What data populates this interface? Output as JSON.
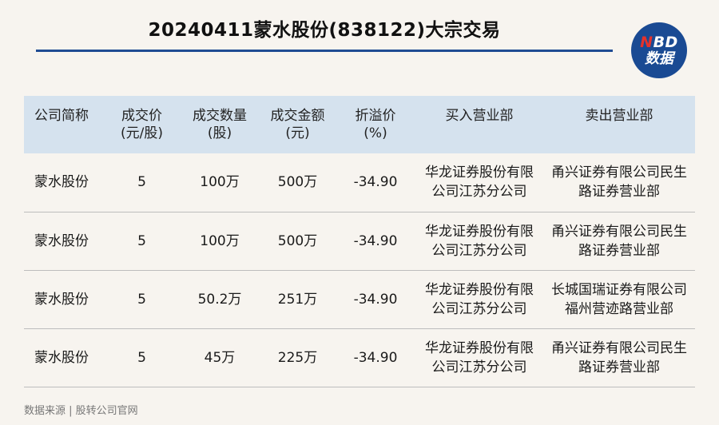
{
  "title": "20240411蒙水股份(838122)大宗交易",
  "logo": {
    "line1_n": "N",
    "line1_rest": "BD",
    "line2": "数据"
  },
  "table": {
    "headers": [
      {
        "line1": "公司简称",
        "line2": ""
      },
      {
        "line1": "成交价",
        "line2": "(元/股)"
      },
      {
        "line1": "成交数量",
        "line2": "(股)"
      },
      {
        "line1": "成交金额",
        "line2": "(元)"
      },
      {
        "line1": "折溢价",
        "line2": "(%)"
      },
      {
        "line1": "买入营业部",
        "line2": ""
      },
      {
        "line1": "卖出营业部",
        "line2": ""
      }
    ],
    "rows": [
      {
        "name": "蒙水股份",
        "price": "5",
        "volume": "100万",
        "amount": "500万",
        "premium": "-34.90",
        "buyer": "华龙证券股份有限公司江苏分公司",
        "seller": "甬兴证券有限公司民生路证券营业部"
      },
      {
        "name": "蒙水股份",
        "price": "5",
        "volume": "100万",
        "amount": "500万",
        "premium": "-34.90",
        "buyer": "华龙证券股份有限公司江苏分公司",
        "seller": "甬兴证券有限公司民生路证券营业部"
      },
      {
        "name": "蒙水股份",
        "price": "5",
        "volume": "50.2万",
        "amount": "251万",
        "premium": "-34.90",
        "buyer": "华龙证券股份有限公司江苏分公司",
        "seller": "长城国瑞证券有限公司福州营迹路营业部"
      },
      {
        "name": "蒙水股份",
        "price": "5",
        "volume": "45万",
        "amount": "225万",
        "premium": "-34.90",
        "buyer": "华龙证券股份有限公司江苏分公司",
        "seller": "甬兴证券有限公司民生路证券营业部"
      }
    ]
  },
  "source": "数据来源 | 股转公司官网",
  "colors": {
    "accent": "#1f4c93",
    "header_bg": "#d5e2ee",
    "background": "#f7f4ef",
    "logo_red": "#e6322b"
  }
}
